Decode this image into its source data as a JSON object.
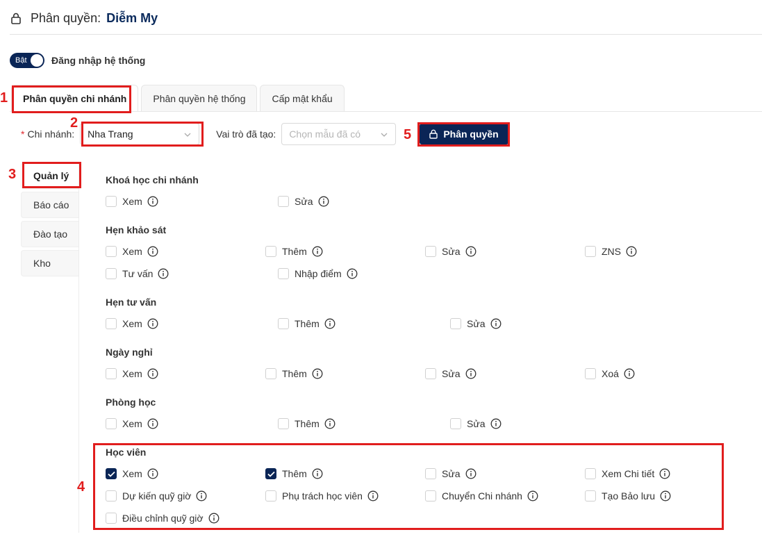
{
  "header": {
    "title": "Phân quyền:",
    "user": "Diễm My",
    "icon": "lock-icon"
  },
  "login_toggle": {
    "state_label": "Bật",
    "label": "Đăng nhập hệ thống",
    "on": true
  },
  "tabs": [
    {
      "label": "Phân quyền chi nhánh",
      "active": true
    },
    {
      "label": "Phân quyền hệ thống",
      "active": false
    },
    {
      "label": "Cấp mật khẩu",
      "active": false
    }
  ],
  "filters": {
    "branch_label": "Chi nhánh:",
    "branch_required_mark": "*",
    "branch_value": "Nha Trang",
    "role_label": "Vai trò đã tạo:",
    "role_placeholder": "Chọn mẫu đã có",
    "submit_label": "Phân quyền"
  },
  "sidebar": [
    {
      "label": "Quản lý",
      "active": true
    },
    {
      "label": "Báo cáo",
      "active": false
    },
    {
      "label": "Đào tạo",
      "active": false
    },
    {
      "label": "Kho",
      "active": false
    }
  ],
  "groups": [
    {
      "title": "Khoá học chi nhánh",
      "rows": [
        [
          {
            "label": "Xem",
            "checked": false
          },
          {
            "label": "Sửa",
            "checked": false
          }
        ]
      ]
    },
    {
      "title": "Hẹn khảo sát",
      "rows": [
        [
          {
            "label": "Xem",
            "checked": false
          },
          {
            "label": "Thêm",
            "checked": false
          },
          {
            "label": "Sửa",
            "checked": false
          },
          {
            "label": "ZNS",
            "checked": false
          }
        ],
        [
          {
            "label": "Tư vấn",
            "checked": false
          },
          {
            "label": "Nhập điểm",
            "checked": false
          }
        ]
      ]
    },
    {
      "title": "Hẹn tư vấn",
      "rows": [
        [
          {
            "label": "Xem",
            "checked": false
          },
          {
            "label": "Thêm",
            "checked": false
          },
          {
            "label": "Sửa",
            "checked": false
          }
        ]
      ]
    },
    {
      "title": "Ngày nghỉ",
      "rows": [
        [
          {
            "label": "Xem",
            "checked": false
          },
          {
            "label": "Thêm",
            "checked": false
          },
          {
            "label": "Sửa",
            "checked": false
          },
          {
            "label": "Xoá",
            "checked": false
          }
        ]
      ]
    },
    {
      "title": "Phòng học",
      "rows": [
        [
          {
            "label": "Xem",
            "checked": false
          },
          {
            "label": "Thêm",
            "checked": false
          },
          {
            "label": "Sửa",
            "checked": false
          }
        ]
      ]
    },
    {
      "title": "Học viên",
      "rows": [
        [
          {
            "label": "Xem",
            "checked": true
          },
          {
            "label": "Thêm",
            "checked": true
          },
          {
            "label": "Sửa",
            "checked": false
          },
          {
            "label": "Xem Chi tiết",
            "checked": false
          }
        ],
        [
          {
            "label": "Dự kiến quỹ giờ",
            "checked": false
          },
          {
            "label": "Phụ trách học viên",
            "checked": false
          },
          {
            "label": "Chuyển Chi nhánh",
            "checked": false
          },
          {
            "label": "Tạo Bảo lưu",
            "checked": false
          }
        ],
        [
          {
            "label": "Điều chỉnh quỹ giờ",
            "checked": false
          }
        ]
      ]
    }
  ],
  "annotations": [
    "1",
    "2",
    "3",
    "4",
    "5"
  ],
  "colors": {
    "primary": "#0a2556",
    "annotation": "#e11d1d",
    "required": "#e0282e"
  }
}
